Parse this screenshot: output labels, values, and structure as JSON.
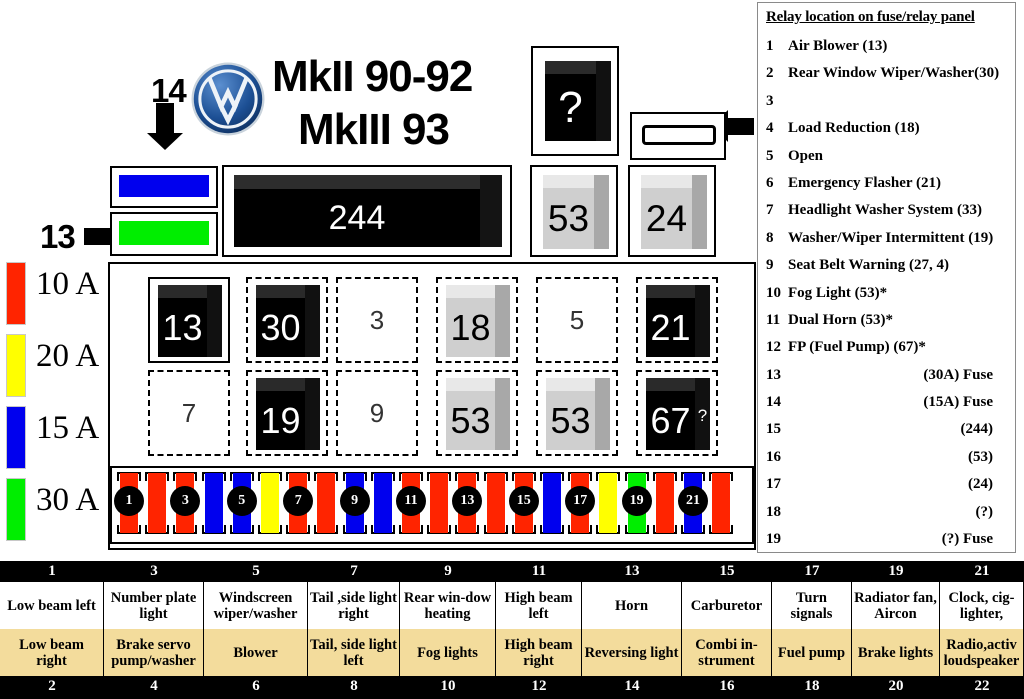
{
  "title": {
    "line1": "MkII 90-92",
    "line2": "MkIII 93",
    "logo": "vw-logo"
  },
  "callouts": {
    "top": "14",
    "left": "13"
  },
  "legend": {
    "items": [
      {
        "amps": "10 A",
        "color": "#FF2400"
      },
      {
        "amps": "20 A",
        "color": "#FFFF00"
      },
      {
        "amps": "15 A",
        "color": "#0000EE"
      },
      {
        "amps": "30 A",
        "color": "#00EE00"
      }
    ]
  },
  "panel": {
    "connector_blue": {
      "label": "",
      "color": "#0000EE"
    },
    "connector_green": {
      "label": "",
      "color": "#00EE00"
    },
    "bar_relay": {
      "value": "244"
    },
    "upper_slots": [
      {
        "value": "?",
        "style": "black-cube"
      },
      {
        "value": "",
        "style": "fuse-link"
      },
      {
        "value": "53",
        "style": "grey-cube"
      },
      {
        "value": "24",
        "style": "grey-cube"
      }
    ],
    "grid": [
      {
        "pos": 1,
        "value": "13",
        "style": "black-cube"
      },
      {
        "pos": 2,
        "value": "30",
        "style": "black-cube"
      },
      {
        "pos": 3,
        "value": "3",
        "style": "empty"
      },
      {
        "pos": 4,
        "value": "18",
        "style": "grey-cube"
      },
      {
        "pos": 5,
        "value": "5",
        "style": "empty"
      },
      {
        "pos": 6,
        "value": "21",
        "style": "black-cube"
      },
      {
        "pos": 7,
        "value": "7",
        "style": "empty"
      },
      {
        "pos": 8,
        "value": "19",
        "style": "black-cube"
      },
      {
        "pos": 9,
        "value": "9",
        "style": "empty"
      },
      {
        "pos": 10,
        "value": "53",
        "style": "grey-cube"
      },
      {
        "pos": 11,
        "value": "53",
        "style": "grey-cube"
      },
      {
        "pos": 12,
        "value": "67",
        "style": "black-cube",
        "extra": "?"
      }
    ]
  },
  "fuses": [
    {
      "n": 1,
      "color": "#FF2400"
    },
    {
      "n": 2,
      "color": "#FF2400"
    },
    {
      "n": 3,
      "color": "#FF2400"
    },
    {
      "n": 4,
      "color": "#0000EE"
    },
    {
      "n": 5,
      "color": "#0000EE"
    },
    {
      "n": 6,
      "color": "#FFFF00"
    },
    {
      "n": 7,
      "color": "#FF2400"
    },
    {
      "n": 8,
      "color": "#FF2400"
    },
    {
      "n": 9,
      "color": "#0000EE"
    },
    {
      "n": 10,
      "color": "#0000EE"
    },
    {
      "n": 11,
      "color": "#FF2400"
    },
    {
      "n": 12,
      "color": "#FF2400"
    },
    {
      "n": 13,
      "color": "#FF2400"
    },
    {
      "n": 14,
      "color": "#FF2400"
    },
    {
      "n": 15,
      "color": "#FF2400"
    },
    {
      "n": 16,
      "color": "#0000EE"
    },
    {
      "n": 17,
      "color": "#FF2400"
    },
    {
      "n": 18,
      "color": "#FFFF00"
    },
    {
      "n": 19,
      "color": "#00EE00"
    },
    {
      "n": 20,
      "color": "#FF2400"
    },
    {
      "n": 21,
      "color": "#0000EE"
    },
    {
      "n": 22,
      "color": "#FF2400"
    }
  ],
  "fuse_labels": [
    "1",
    "3",
    "5",
    "7",
    "9",
    "11",
    "13",
    "15",
    "17",
    "19",
    "21"
  ],
  "relay_list": {
    "title": "Relay location on fuse/relay panel",
    "rows": [
      {
        "num": "1",
        "text": "Air Blower  (13)",
        "align": "left"
      },
      {
        "num": "2",
        "text": "Rear Window Wiper/Washer(30)",
        "align": "left"
      },
      {
        "num": "3",
        "text": "",
        "align": "left"
      },
      {
        "num": "4",
        "text": "Load Reduction (18)",
        "align": "left"
      },
      {
        "num": "5",
        "text": "Open",
        "align": "left"
      },
      {
        "num": "6",
        "text": "Emergency Flasher (21)",
        "align": "left"
      },
      {
        "num": "7",
        "text": "Headlight Washer System (33)",
        "align": "left"
      },
      {
        "num": "8",
        "text": "Washer/Wiper Intermittent (19)",
        "align": "left"
      },
      {
        "num": "9",
        "text": "Seat Belt Warning (27, 4)",
        "align": "left"
      },
      {
        "num": "10",
        "text": "Fog Light (53)*",
        "align": "left"
      },
      {
        "num": "11",
        "text": "Dual Horn (53)*",
        "align": "left"
      },
      {
        "num": "12",
        "text": "FP (Fuel Pump) (67)*",
        "align": "left"
      },
      {
        "num": "13",
        "text": "(30A) Fuse",
        "align": "right"
      },
      {
        "num": "14",
        "text": "(15A) Fuse",
        "align": "right"
      },
      {
        "num": "15",
        "text": "(244)",
        "align": "right"
      },
      {
        "num": "16",
        "text": "(53)",
        "align": "right"
      },
      {
        "num": "17",
        "text": "(24)",
        "align": "right"
      },
      {
        "num": "18",
        "text": "(?)",
        "align": "right"
      },
      {
        "num": "19",
        "text": "(?) Fuse",
        "align": "right"
      }
    ]
  },
  "fuse_table": {
    "odd_numbers": [
      "1",
      "3",
      "5",
      "7",
      "9",
      "11",
      "13",
      "15",
      "17",
      "19",
      "21"
    ],
    "even_numbers": [
      "2",
      "4",
      "6",
      "8",
      "10",
      "12",
      "14",
      "16",
      "18",
      "20",
      "22"
    ],
    "odd_labels": [
      "Low beam left",
      "Number plate light",
      "Windscreen wiper/washer",
      "Tail ,side light right",
      "Rear win-dow heating",
      "High beam left",
      "Horn",
      "Carburetor",
      "Turn signals",
      "Radiator fan, Aircon",
      "Clock, cig-lighter,"
    ],
    "even_labels": [
      "Low beam right",
      "Brake servo pump/washer",
      "Blower",
      "Tail, side light left",
      "Fog lights",
      "High beam right",
      "Reversing light",
      "Combi in-strument",
      "Fuel pump",
      "Brake lights",
      "Radio,activ loudspeaker"
    ]
  }
}
